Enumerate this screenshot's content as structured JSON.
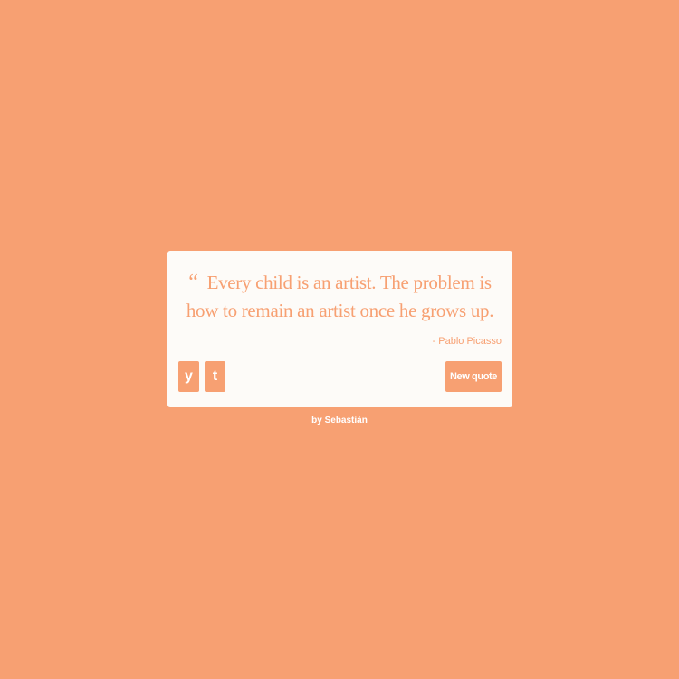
{
  "colors": {
    "background": "#f7a072",
    "card": "#fdfbf8",
    "accent": "#f7a072",
    "button_text": "#ffffff"
  },
  "quote": {
    "mark": "“",
    "text": "Every child is an artist. The problem is how to remain an artist once he grows up.",
    "author": "- Pablo Picasso"
  },
  "buttons": {
    "twitter": {
      "icon": "twitter-icon",
      "glyph": "y"
    },
    "tumblr": {
      "icon": "tumblr-icon",
      "glyph": "t"
    },
    "new_quote_label": "New quote"
  },
  "footer": {
    "text": "by Sebastián"
  }
}
